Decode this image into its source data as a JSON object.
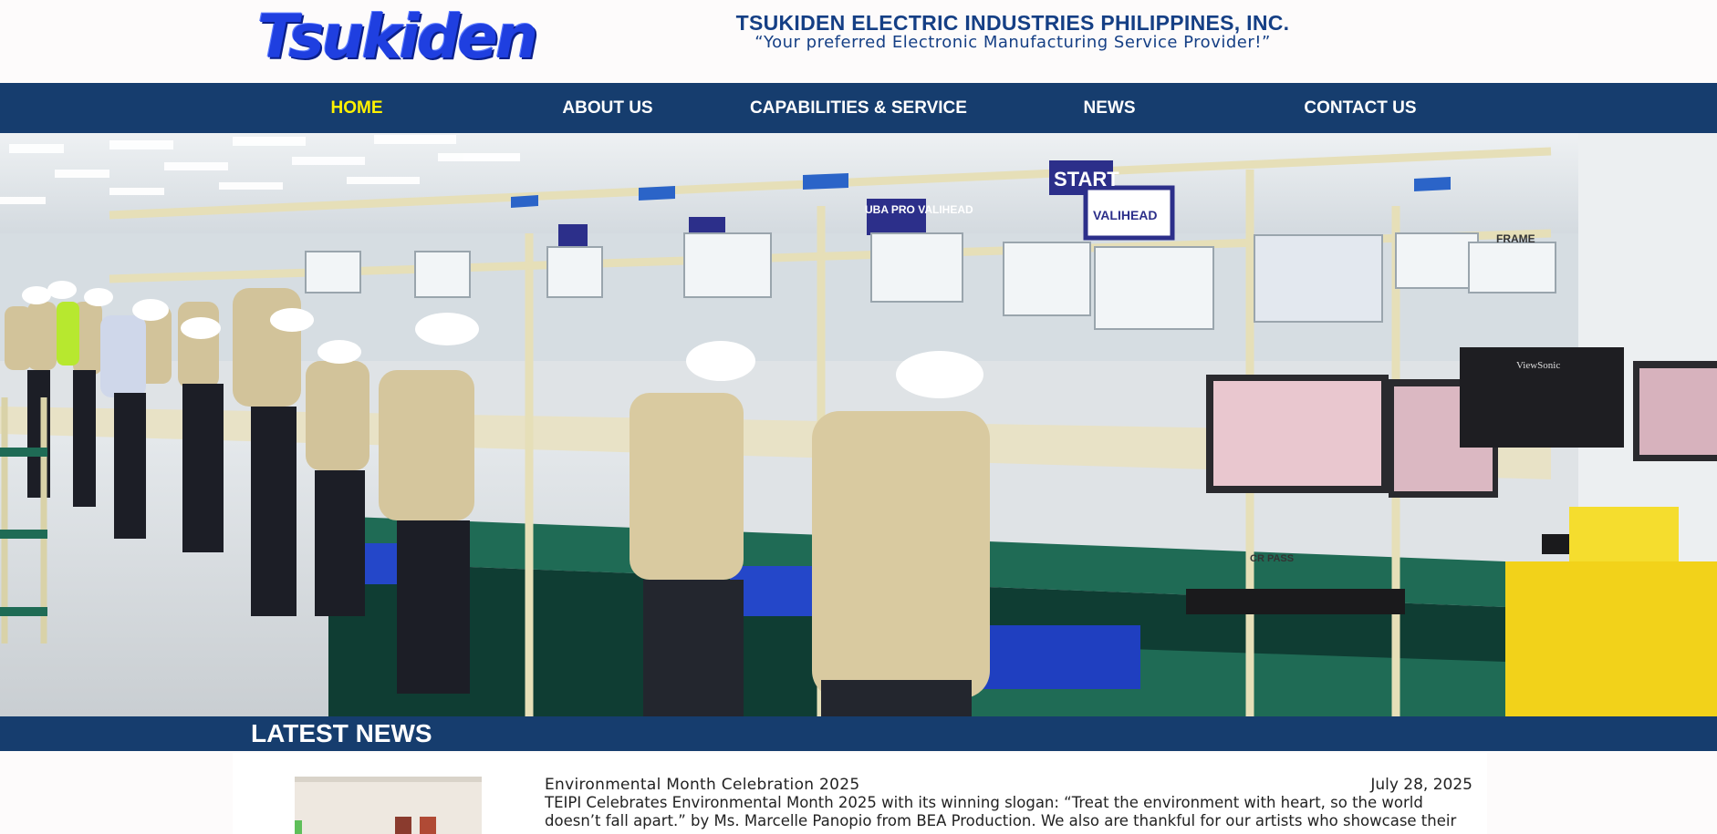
{
  "header": {
    "logo_text": "Tsukiden",
    "company_name": "TSUKIDEN ELECTRIC INDUSTRIES PHILIPPINES, INC.",
    "slogan": "“Your preferred Electronic Manufacturing Service Provider!”"
  },
  "nav": {
    "items": [
      {
        "label": "HOME",
        "active": true
      },
      {
        "label": "ABOUT US",
        "active": false
      },
      {
        "label": "CAPABILITIES & SERVICE",
        "active": false
      },
      {
        "label": "NEWS",
        "active": false
      },
      {
        "label": "CONTACT US",
        "active": false
      }
    ]
  },
  "hero": {
    "signs": [
      "START",
      "UBA PRO VALIHEAD",
      "VALIHEAD",
      "FRAME",
      "CR PASS",
      "ViewSonic"
    ]
  },
  "latest_news": {
    "heading": "LATEST NEWS",
    "items": [
      {
        "title": "Environmental Month Celebration 2025",
        "date": "July 28, 2025",
        "excerpt": "TEIPI Celebrates Environmental Month 2025 with its winning slogan: “Treat the environment with heart, so the world doesn’t fall apart.” by Ms. Marcelle Panopio from BEA Production. We also are thankful for our artists who showcase their"
      }
    ]
  },
  "colors": {
    "nav_bg": "#163d6e",
    "nav_active": "#fff200",
    "brand_blue": "#1f3fe0",
    "heading_blue": "#153f85"
  }
}
